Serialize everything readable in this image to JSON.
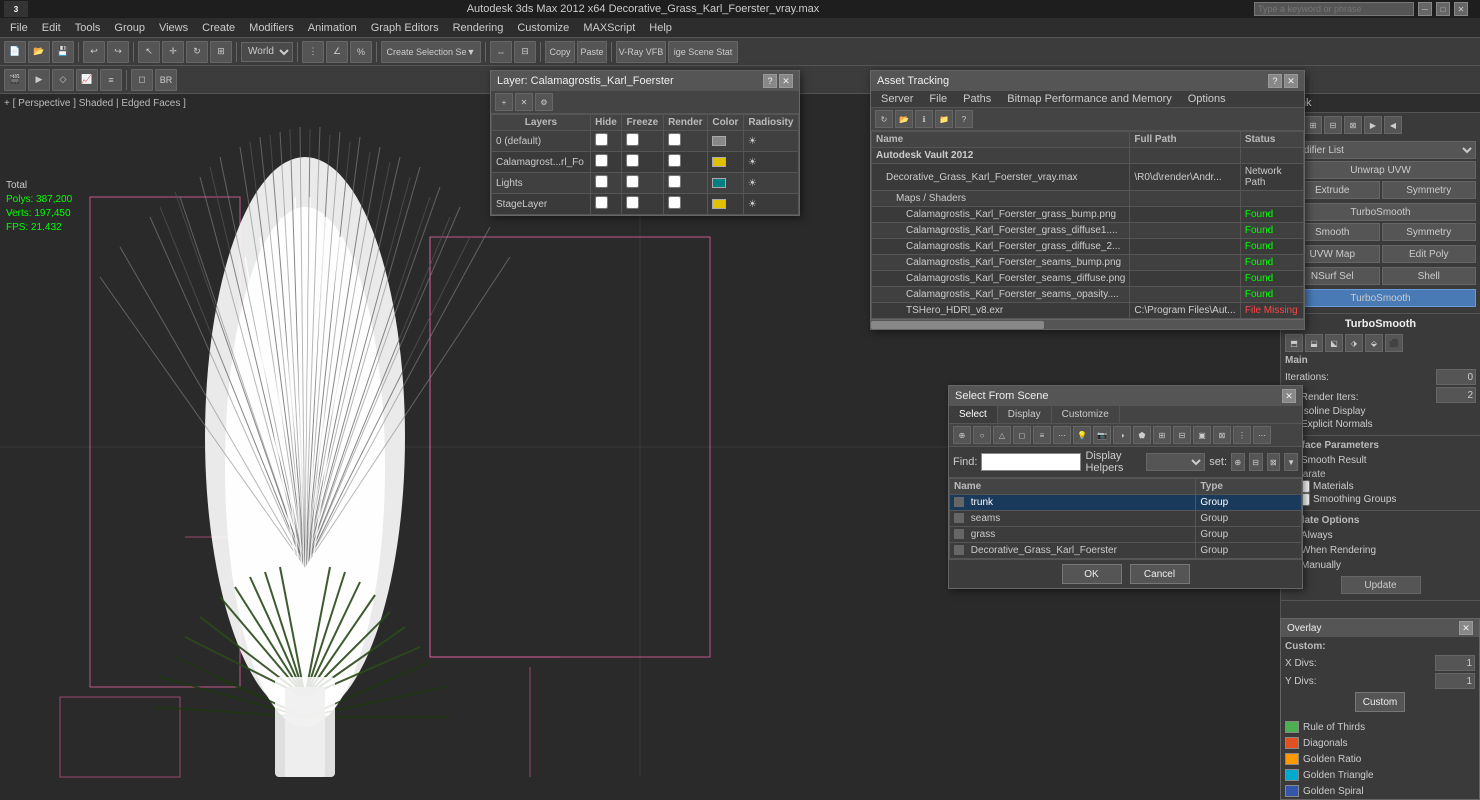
{
  "app": {
    "title": "Autodesk 3ds Max 2012 x64    Decorative_Grass_Karl_Foerster_vray.max",
    "search_placeholder": "Type a keyword or phrase"
  },
  "menu": {
    "items": [
      "File",
      "Edit",
      "Tools",
      "Group",
      "Views",
      "Create",
      "Modifiers",
      "Animation",
      "Graph Editors",
      "Rendering",
      "Customize",
      "MAXScript",
      "Help"
    ]
  },
  "toolbar": {
    "world_label": "World",
    "copy_label": "Copy",
    "paste_label": "Paste",
    "vray_vfb": "V-Ray VFB",
    "ige_scene": "ige Scene Stat",
    "br_label": "BR"
  },
  "viewport": {
    "label": "+ [ Perspective ] Shaded | Edged Faces ]",
    "stats": {
      "total": "Total",
      "polys_label": "Polys:",
      "polys_value": "387,200",
      "verts_label": "Verts:",
      "verts_value": "197,450",
      "fps_label": "FPS:",
      "fps_value": "21.432"
    }
  },
  "layer_dialog": {
    "title": "Layer: Calamagrostis_Karl_Foerster",
    "columns": [
      "Layers",
      "Hide",
      "Freeze",
      "Render",
      "Color",
      "Radiosity"
    ],
    "rows": [
      {
        "name": "0 (default)",
        "hide": "",
        "freeze": "",
        "render": "",
        "color": "gray",
        "radiosity": ""
      },
      {
        "name": "Calamagrost...rl_Fo",
        "hide": "",
        "freeze": "",
        "render": "",
        "color": "yellow",
        "radiosity": ""
      },
      {
        "name": "Lights",
        "hide": "",
        "freeze": "",
        "render": "",
        "color": "teal",
        "radiosity": ""
      },
      {
        "name": "StageLayer",
        "hide": "",
        "freeze": "",
        "render": "",
        "color": "yellow",
        "radiosity": ""
      }
    ]
  },
  "asset_dialog": {
    "title": "Asset Tracking",
    "menu_items": [
      "Server",
      "File",
      "Paths",
      "Bitmap Performance and Memory",
      "Options"
    ],
    "columns": [
      "Name",
      "Full Path",
      "Status"
    ],
    "rows": [
      {
        "name": "Autodesk Vault 2012",
        "path": "",
        "status": "",
        "indent": 0
      },
      {
        "name": "Decorative_Grass_Karl_Foerster_vray.max",
        "path": "\\R0\\d\\render\\Andr...",
        "status": "Network Path",
        "indent": 1
      },
      {
        "name": "Maps / Shaders",
        "path": "",
        "status": "",
        "indent": 2
      },
      {
        "name": "Calamagrostis_Karl_Foerster_grass_bump.png",
        "path": "",
        "status": "Found",
        "indent": 3
      },
      {
        "name": "Calamagrostis_Karl_Foerster_grass_diffuse1....",
        "path": "",
        "status": "Found",
        "indent": 3
      },
      {
        "name": "Calamagrostis_Karl_Foerster_grass_diffuse_2...",
        "path": "",
        "status": "Found",
        "indent": 3
      },
      {
        "name": "Calamagrostis_Karl_Foerster_seams_bump.png",
        "path": "",
        "status": "Found",
        "indent": 3
      },
      {
        "name": "Calamagrostis_Karl_Foerster_seams_diffuse.png",
        "path": "",
        "status": "Found",
        "indent": 3
      },
      {
        "name": "Calamagrostis_Karl_Foerster_seams_opasity....",
        "path": "",
        "status": "Found",
        "indent": 3
      },
      {
        "name": "TSHero_HDRI_v8.exr",
        "path": "C:\\Program Files\\Aut...",
        "status": "File Missing",
        "indent": 3
      }
    ]
  },
  "scene_dialog": {
    "title": "Select From Scene",
    "tabs": [
      "Select",
      "Display",
      "Customize"
    ],
    "active_tab": "Select",
    "find_label": "Find:",
    "find_value": "",
    "display_helpers_label": "Display Helpers",
    "set_label": "set:",
    "columns": [
      "Name",
      "Type"
    ],
    "rows": [
      {
        "name": "trunk",
        "type": "Group",
        "selected": true
      },
      {
        "name": "seams",
        "type": "Group",
        "selected": false
      },
      {
        "name": "grass",
        "type": "Group",
        "selected": false
      },
      {
        "name": "Decorative_Grass_Karl_Foerster",
        "type": "Group",
        "selected": false
      }
    ],
    "ok_label": "OK",
    "cancel_label": "Cancel"
  },
  "right_panel": {
    "title": "trunk",
    "modifier_list_label": "Modifier List",
    "modifiers": [
      {
        "label": "Unwrap UVW",
        "active": false
      },
      {
        "label": "TurboSmooth",
        "active": false
      },
      {
        "label": "Smooth",
        "active": false
      },
      {
        "label": "UVW Map",
        "active": false
      },
      {
        "label": "NSurf Sel",
        "active": false
      },
      {
        "label": "TurboSmooth",
        "active": true
      }
    ],
    "extrude_label": "Extrude",
    "symmetry_label": "Symmetry",
    "edit_poly_label": "Edit Poly",
    "shell_label": "Shell",
    "turbosmooth_section": {
      "title": "TurboSmooth",
      "main_label": "Main",
      "iterations_label": "Iterations:",
      "iterations_value": "0",
      "render_iters_label": "Render Iters:",
      "render_iters_value": "2",
      "isoline_label": "Isoline Display",
      "explicit_label": "Explicit Normals"
    },
    "surface_params": {
      "title": "Surface Parameters",
      "smooth_result_label": "Smooth Result",
      "separate_label": "Separate",
      "materials_label": "Materials",
      "smoothing_groups_label": "Smoothing Groups"
    },
    "update_options": {
      "title": "Update Options",
      "always_label": "Always",
      "when_rendering_label": "When Rendering",
      "manually_label": "Manually",
      "update_button": "Update"
    }
  },
  "overlay_panel": {
    "title": "Overlay",
    "custom_label": "Custom:",
    "x_divs_label": "X Divs:",
    "x_divs_value": "1",
    "y_divs_label": "Y Divs:",
    "y_divs_value": "1",
    "items": [
      {
        "color": "#4CAF50",
        "label": "Custom"
      },
      {
        "color": "#e0c000",
        "label": "Rule of Thirds"
      },
      {
        "color": "#e05020",
        "label": "Diagonals"
      },
      {
        "color": "#ff9900",
        "label": "Golden Ratio"
      },
      {
        "color": "#00aacc",
        "label": "Golden Triangle"
      },
      {
        "color": "#3355aa",
        "label": "Golden Spiral"
      }
    ]
  }
}
